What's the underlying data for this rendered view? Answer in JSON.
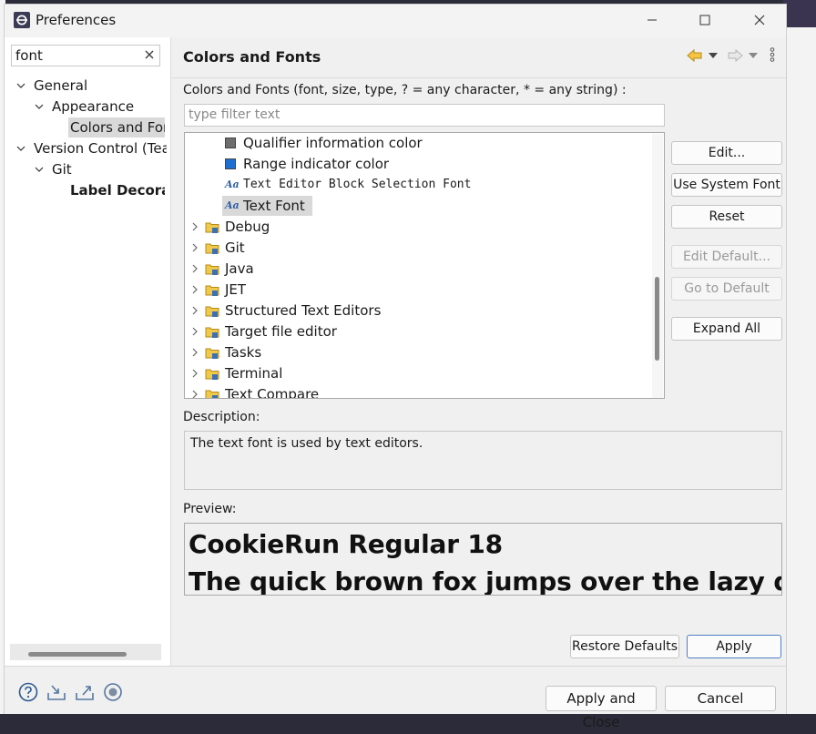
{
  "window": {
    "title": "Preferences",
    "controls": [
      "minimize",
      "maximize",
      "close"
    ]
  },
  "left_pane": {
    "filter_value": "font",
    "tree": [
      {
        "label": "General",
        "level": 0,
        "expanded": true
      },
      {
        "label": "Appearance",
        "level": 1,
        "expanded": true
      },
      {
        "label": "Colors and Fonts",
        "level": 2,
        "selected": true
      },
      {
        "label": "Version Control (Team)",
        "level": 0,
        "expanded": true
      },
      {
        "label": "Git",
        "level": 1,
        "expanded": true
      },
      {
        "label": "Label Decorations",
        "level": 2,
        "bold": true
      }
    ]
  },
  "page": {
    "title": "Colors and Fonts",
    "section_label": "Colors and Fonts (font, size, type, ? = any character, * = any string) :",
    "filter_placeholder": "type filter text",
    "list_items": [
      {
        "label": "Qualifier information color",
        "kind": "color",
        "color": "#6e6e6e"
      },
      {
        "label": "Range indicator color",
        "kind": "color",
        "color": "#1f6fd1"
      },
      {
        "label": "Text Editor Block Selection Font",
        "kind": "font"
      },
      {
        "label": "Text Font",
        "kind": "font",
        "selected": true
      },
      {
        "label": "Debug",
        "kind": "category"
      },
      {
        "label": "Git",
        "kind": "category"
      },
      {
        "label": "Java",
        "kind": "category"
      },
      {
        "label": "JET",
        "kind": "category"
      },
      {
        "label": "Structured Text Editors",
        "kind": "category"
      },
      {
        "label": "Target file editor",
        "kind": "category"
      },
      {
        "label": "Tasks",
        "kind": "category"
      },
      {
        "label": "Terminal",
        "kind": "category"
      },
      {
        "label": "Text Compare",
        "kind": "category"
      }
    ],
    "buttons": {
      "edit": "Edit...",
      "use_system_font": "Use System Font",
      "reset": "Reset",
      "edit_default": "Edit Default...",
      "go_to_default": "Go to Default",
      "expand_all": "Expand All"
    },
    "description_label": "Description:",
    "description_text": "The text font is used by text editors.",
    "preview_label": "Preview:",
    "preview_line1": "CookieRun Regular 18",
    "preview_line2": "The quick brown fox jumps over the lazy dog",
    "restore_defaults": "Restore Defaults",
    "apply": "Apply"
  },
  "footer": {
    "apply_and_close": "Apply and Close",
    "cancel": "Cancel"
  },
  "colors": {
    "accent": "#4f7fc4",
    "selection": "#d9d9d9",
    "aa_icon": "#2e5fa3"
  }
}
